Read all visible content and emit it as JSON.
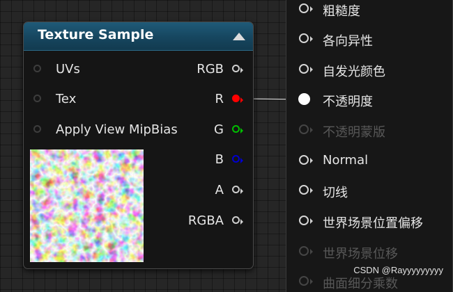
{
  "node": {
    "title": "Texture Sample",
    "inputs": [
      "UVs",
      "Tex",
      "Apply View MipBias"
    ],
    "outputs": [
      {
        "label": "RGB",
        "color": "#d0d0d0"
      },
      {
        "label": "R",
        "color": "#ff0000"
      },
      {
        "label": "G",
        "color": "#00c000"
      },
      {
        "label": "B",
        "color": "#0000d0"
      },
      {
        "label": "A",
        "color": "#d0d0d0"
      },
      {
        "label": "RGBA",
        "color": "#d0d0d0"
      }
    ]
  },
  "result": {
    "pins": [
      {
        "label": "粗糙度",
        "enabled": true
      },
      {
        "label": "各向异性",
        "enabled": true
      },
      {
        "label": "自发光颜色",
        "enabled": true
      },
      {
        "label": "不透明度",
        "enabled": true,
        "connected": true
      },
      {
        "label": "不透明蒙版",
        "enabled": false
      },
      {
        "label": "Normal",
        "enabled": true
      },
      {
        "label": "切线",
        "enabled": true
      },
      {
        "label": "世界场景位置偏移",
        "enabled": true
      },
      {
        "label": "世界场景位移",
        "enabled": false
      },
      {
        "label": "曲面细分乘数",
        "enabled": false
      }
    ]
  },
  "watermark": "CSDN @Rayyyyyyyyy"
}
